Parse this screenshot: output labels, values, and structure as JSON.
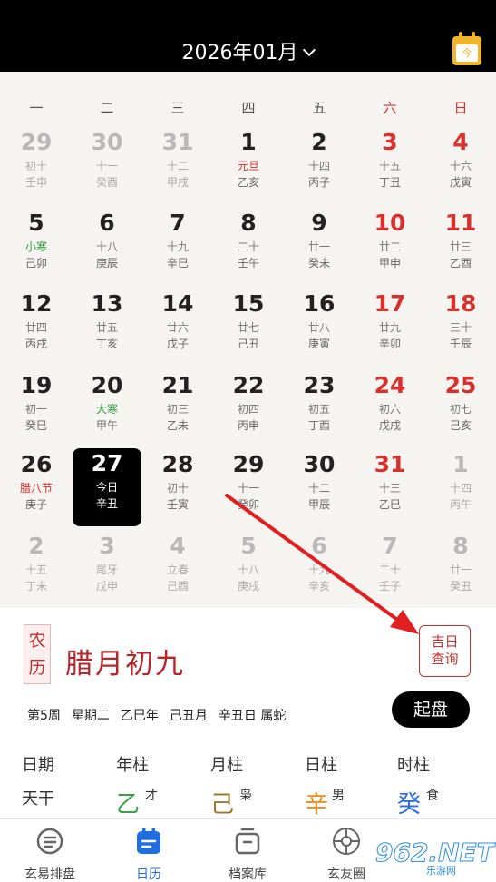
{
  "header": {
    "month_title": "2026年01月",
    "today_button_label": "今"
  },
  "weekdays": [
    "一",
    "二",
    "三",
    "四",
    "五",
    "六",
    "日"
  ],
  "calendar": {
    "rows": [
      [
        {
          "day": "29",
          "lunar": "初十",
          "gz": "壬申",
          "kind": "other"
        },
        {
          "day": "30",
          "lunar": "十一",
          "gz": "癸酉",
          "kind": "other"
        },
        {
          "day": "31",
          "lunar": "十二",
          "gz": "甲戌",
          "kind": "other"
        },
        {
          "day": "1",
          "lunar": "元旦",
          "gz": "乙亥",
          "kind": "normal",
          "lunar_type": "holiday"
        },
        {
          "day": "2",
          "lunar": "十四",
          "gz": "丙子",
          "kind": "normal"
        },
        {
          "day": "3",
          "lunar": "十五",
          "gz": "丁丑",
          "kind": "red"
        },
        {
          "day": "4",
          "lunar": "十六",
          "gz": "戊寅",
          "kind": "red"
        }
      ],
      [
        {
          "day": "5",
          "lunar": "小寒",
          "gz": "己卯",
          "kind": "normal",
          "lunar_type": "term"
        },
        {
          "day": "6",
          "lunar": "十八",
          "gz": "庚辰",
          "kind": "normal"
        },
        {
          "day": "7",
          "lunar": "十九",
          "gz": "辛巳",
          "kind": "normal"
        },
        {
          "day": "8",
          "lunar": "二十",
          "gz": "壬午",
          "kind": "normal"
        },
        {
          "day": "9",
          "lunar": "廿一",
          "gz": "癸未",
          "kind": "normal"
        },
        {
          "day": "10",
          "lunar": "廿二",
          "gz": "甲申",
          "kind": "red"
        },
        {
          "day": "11",
          "lunar": "廿三",
          "gz": "乙酉",
          "kind": "red"
        }
      ],
      [
        {
          "day": "12",
          "lunar": "廿四",
          "gz": "丙戌",
          "kind": "normal"
        },
        {
          "day": "13",
          "lunar": "廿五",
          "gz": "丁亥",
          "kind": "normal"
        },
        {
          "day": "14",
          "lunar": "廿六",
          "gz": "戊子",
          "kind": "normal"
        },
        {
          "day": "15",
          "lunar": "廿七",
          "gz": "己丑",
          "kind": "normal"
        },
        {
          "day": "16",
          "lunar": "廿八",
          "gz": "庚寅",
          "kind": "normal"
        },
        {
          "day": "17",
          "lunar": "廿九",
          "gz": "辛卯",
          "kind": "red"
        },
        {
          "day": "18",
          "lunar": "三十",
          "gz": "壬辰",
          "kind": "red"
        }
      ],
      [
        {
          "day": "19",
          "lunar": "初一",
          "gz": "癸巳",
          "kind": "normal"
        },
        {
          "day": "20",
          "lunar": "大寒",
          "gz": "甲午",
          "kind": "normal",
          "lunar_type": "term"
        },
        {
          "day": "21",
          "lunar": "初三",
          "gz": "乙未",
          "kind": "normal"
        },
        {
          "day": "22",
          "lunar": "初四",
          "gz": "丙申",
          "kind": "normal"
        },
        {
          "day": "23",
          "lunar": "初五",
          "gz": "丁酉",
          "kind": "normal"
        },
        {
          "day": "24",
          "lunar": "初六",
          "gz": "戊戌",
          "kind": "red"
        },
        {
          "day": "25",
          "lunar": "初七",
          "gz": "己亥",
          "kind": "red"
        }
      ],
      [
        {
          "day": "26",
          "lunar": "腊八节",
          "gz": "庚子",
          "kind": "normal",
          "lunar_type": "holiday"
        },
        {
          "day": "27",
          "lunar": "今日",
          "gz": "辛丑",
          "kind": "selected"
        },
        {
          "day": "28",
          "lunar": "初十",
          "gz": "壬寅",
          "kind": "normal"
        },
        {
          "day": "29",
          "lunar": "十一",
          "gz": "癸卯",
          "kind": "normal"
        },
        {
          "day": "30",
          "lunar": "十二",
          "gz": "甲辰",
          "kind": "normal"
        },
        {
          "day": "31",
          "lunar": "十三",
          "gz": "乙巳",
          "kind": "red"
        },
        {
          "day": "1",
          "lunar": "十四",
          "gz": "丙午",
          "kind": "other"
        }
      ],
      [
        {
          "day": "2",
          "lunar": "十五",
          "gz": "丁未",
          "kind": "other"
        },
        {
          "day": "3",
          "lunar": "尾牙",
          "gz": "戊申",
          "kind": "other"
        },
        {
          "day": "4",
          "lunar": "立春",
          "gz": "己酉",
          "kind": "other"
        },
        {
          "day": "5",
          "lunar": "十八",
          "gz": "庚戌",
          "kind": "other"
        },
        {
          "day": "6",
          "lunar": "十九",
          "gz": "辛亥",
          "kind": "other"
        },
        {
          "day": "7",
          "lunar": "二十",
          "gz": "壬子",
          "kind": "other"
        },
        {
          "day": "8",
          "lunar": "廿一",
          "gz": "癸丑",
          "kind": "other"
        }
      ]
    ]
  },
  "info": {
    "seal_chars": [
      "农",
      "历"
    ],
    "lunar_date": "腊月初九",
    "jiri_button": [
      "吉日",
      "查询"
    ],
    "details": [
      "第5周",
      "星期二",
      "乙巳年",
      "己丑月",
      "辛丑日 属蛇"
    ],
    "qipan_button": "起盘"
  },
  "pillars": {
    "headers": [
      "日期",
      "年柱",
      "月柱",
      "日柱",
      "时柱"
    ],
    "row_label": "天干",
    "stems": [
      {
        "char": "乙",
        "god": "才",
        "color": "#3aa14a"
      },
      {
        "char": "己",
        "god": "枭",
        "color": "#a0782d"
      },
      {
        "char": "辛",
        "god": "男",
        "color": "#f08a18"
      },
      {
        "char": "癸",
        "god": "食",
        "color": "#2a6fd6"
      }
    ]
  },
  "tabbar": {
    "tabs": [
      {
        "label": "玄易排盘",
        "icon": "paipan-icon",
        "active": false
      },
      {
        "label": "日历",
        "icon": "calendar-icon",
        "active": true
      },
      {
        "label": "档案库",
        "icon": "archive-icon",
        "active": false
      },
      {
        "label": "玄友圈",
        "icon": "circle-icon",
        "active": false
      }
    ]
  },
  "watermark": {
    "text": "962.NET",
    "sub": "乐游网"
  },
  "colors": {
    "accent_blue": "#1f6ee0",
    "red": "#d7312d",
    "header_bg": "#000000",
    "arrow": "#e02020"
  }
}
